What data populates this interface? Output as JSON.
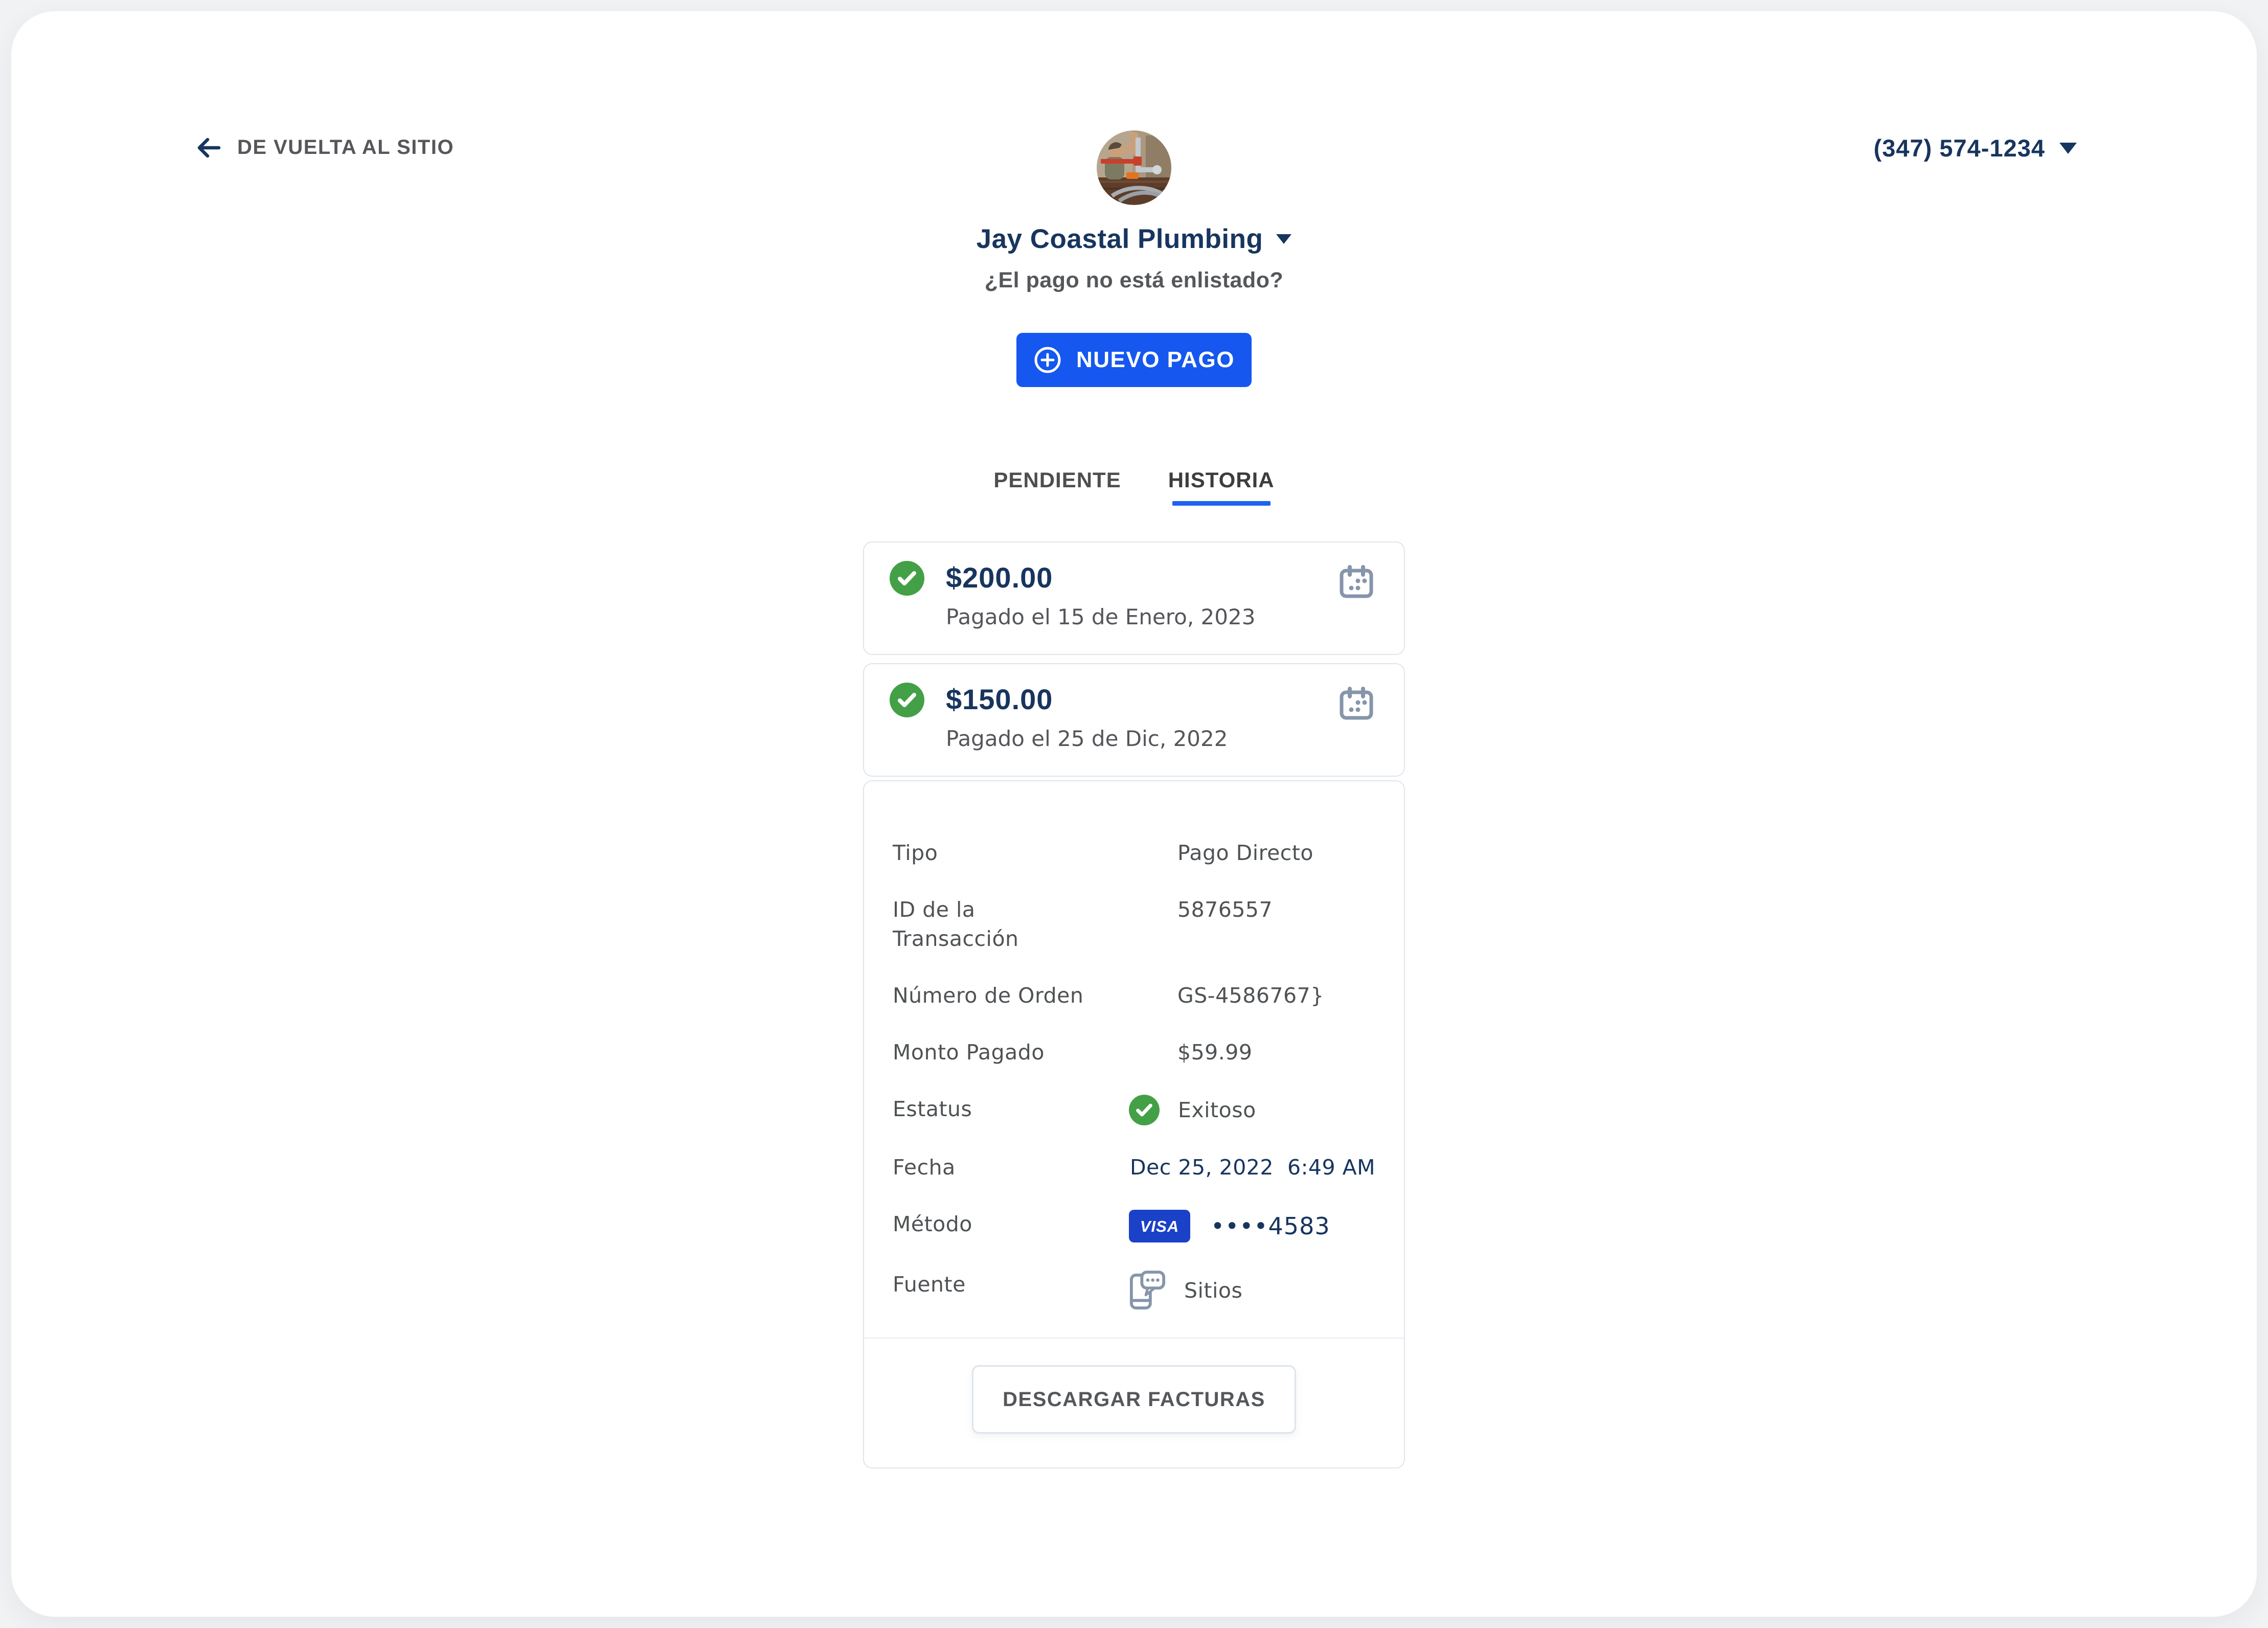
{
  "header": {
    "back_label": "DE VUELTA AL SITIO",
    "phone": "(347) 574-1234"
  },
  "profile": {
    "name": "Jay Coastal Plumbing",
    "question": "¿El pago no está enlistado?",
    "new_payment_label": "NUEVO PAGO"
  },
  "tabs": {
    "pending": "PENDIENTE",
    "history": "HISTORIA"
  },
  "payments": [
    {
      "amount": "$200.00",
      "paid": "Pagado el 15 de Enero, 2023",
      "status": "success"
    },
    {
      "amount": "$150.00",
      "paid": "Pagado el 25 de Dic, 2022",
      "status": "success"
    }
  ],
  "details": {
    "rows": [
      {
        "label": "Tipo",
        "value": "Pago Directo"
      },
      {
        "label": "ID de la Transacción",
        "value": "5876557"
      },
      {
        "label": "Número de Orden",
        "value": "GS-4586767}"
      },
      {
        "label": "Monto Pagado",
        "value": "$59.99"
      },
      {
        "label": "Estatus",
        "value": "Exitoso"
      },
      {
        "label": "Fecha",
        "value": "Dec 25, 2022  6:49 AM"
      },
      {
        "label": "Método",
        "value": "••••4583",
        "badge": "VISA"
      },
      {
        "label": "Fuente",
        "value": "Sitios"
      }
    ],
    "download_label": "DESCARGAR FACTURAS"
  },
  "colors": {
    "accent_blue": "#1657ef",
    "tab_underline_blue": "#1e62f0",
    "navy_text": "#17355e",
    "success_green": "#43a047",
    "visa_blue": "#1b41c8",
    "icon_gray": "#8695aa",
    "muted_text": "#55575a",
    "card_border": "#dfe5ed"
  }
}
